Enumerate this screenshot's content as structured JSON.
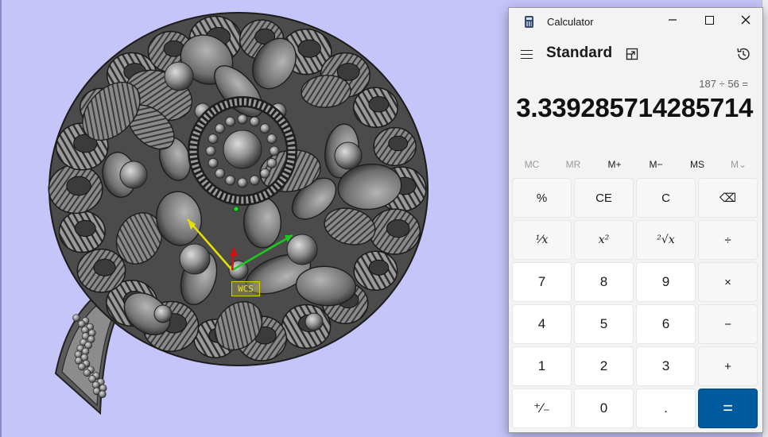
{
  "calculator": {
    "window_title": "Calculator",
    "window_buttons": {
      "minimize": "—",
      "maximize": "",
      "close": "✕"
    },
    "mode": "Standard",
    "expression": "187 ÷ 56 =",
    "result": "3.339285714285714",
    "memory_buttons": [
      {
        "label": "MC",
        "enabled": false
      },
      {
        "label": "MR",
        "enabled": false
      },
      {
        "label": "M+",
        "enabled": true
      },
      {
        "label": "M−",
        "enabled": true
      },
      {
        "label": "MS",
        "enabled": true
      },
      {
        "label": "M⌄",
        "enabled": false
      }
    ],
    "keys": {
      "percent": "%",
      "clear_entry": "CE",
      "clear": "C",
      "backspace": "⌫",
      "reciprocal": "¹⁄x",
      "square": "x²",
      "square_root": "²√x",
      "divide": "÷",
      "seven": "7",
      "eight": "8",
      "nine": "9",
      "multiply": "×",
      "four": "4",
      "five": "5",
      "six": "6",
      "minus": "−",
      "one": "1",
      "two": "2",
      "three": "3",
      "plus": "+",
      "negate": "⁺⁄₋",
      "zero": "0",
      "decimal": ".",
      "equals": "="
    },
    "colors": {
      "equals_bg": "#005a9e",
      "window_bg": "#f3f3f3"
    }
  },
  "viewport": {
    "background": "#c6c5fa",
    "wcs_label": "WCS"
  }
}
